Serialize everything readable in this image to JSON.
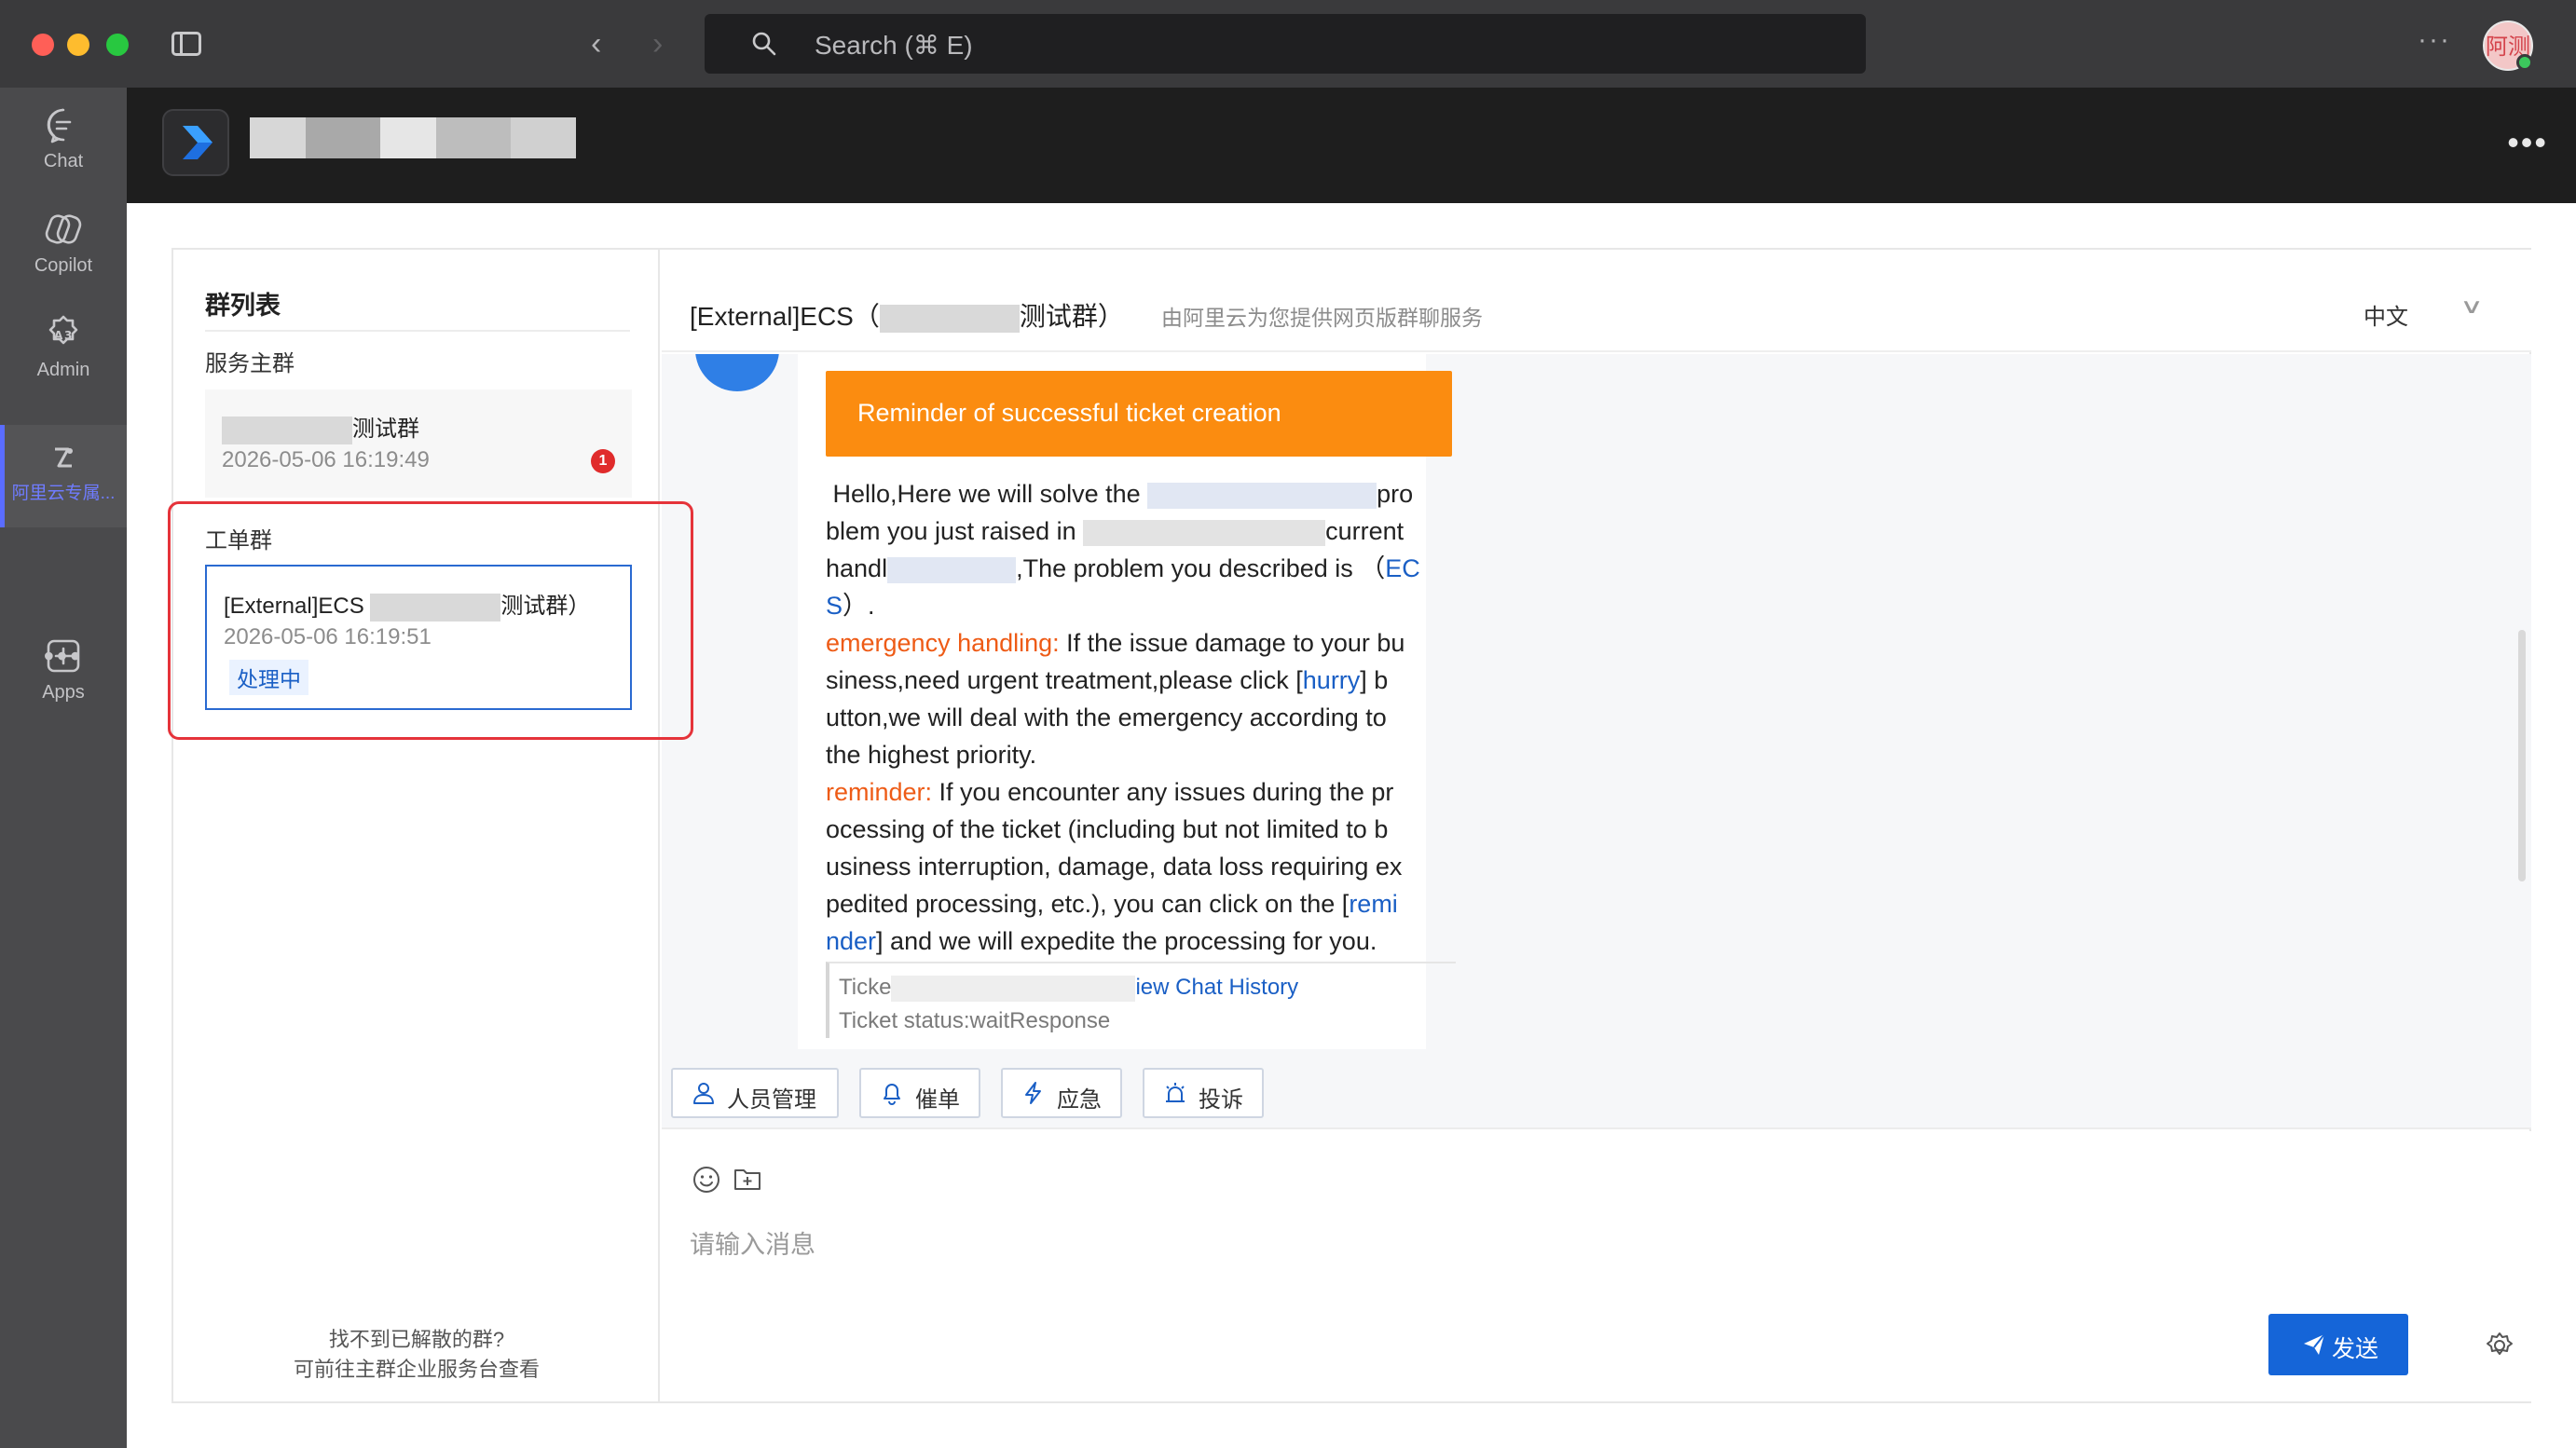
{
  "window": {
    "search_placeholder": "Search (⌘ E)",
    "avatar_text": "阿测",
    "nav_back": "‹",
    "nav_forward": "›",
    "more": "···"
  },
  "rail": {
    "items": [
      {
        "label": "Chat",
        "icon": "chat-bubble-icon"
      },
      {
        "label": "Copilot",
        "icon": "copilot-icon"
      },
      {
        "label": "Admin",
        "icon": "admin-icon"
      },
      {
        "label": "阿里云专属...",
        "icon": "aliyun-app-icon"
      },
      {
        "label": "Apps",
        "icon": "plus-square-icon"
      }
    ],
    "more": "•••"
  },
  "app_header": {
    "more": "•••"
  },
  "group_list": {
    "title": "群列表",
    "service_section_label": "服务主群",
    "service_group": {
      "name_suffix": "测试群",
      "time": "2026-05-06 16:19:49",
      "unread": "1"
    },
    "ticket_section_label": "工单群",
    "ticket_group": {
      "name_prefix": "[External]ECS",
      "name_suffix": "测试群）",
      "time": "2026-05-06 16:19:51",
      "status": "处理中"
    },
    "footer_line1": "找不到已解散的群?",
    "footer_line2": "可前往主群企业服务台查看"
  },
  "chat": {
    "title_prefix": "[External]ECS（",
    "title_suffix": "测试群）",
    "subtitle": "由阿里云为您提供网页版群聊服务",
    "language": "中文",
    "language_arrow": "∨",
    "banner": "Reminder of successful ticket creation",
    "body": {
      "l1a": "Hello,Here we will solve the ",
      "l1b": "pro",
      "l2a": "blem you just raised in ",
      "l2b": "current",
      "l3a": "handl",
      "l3b": ",The problem you described is （",
      "l3c": "EC",
      "l4a": "S",
      "l4b": "）.",
      "emergency_label": "emergency handling:",
      "emergency_text1": " If the issue damage to your bu siness,need urgent treatment,please click [",
      "hurry": "hurry",
      "emergency_text2": "] b utton,we will deal with the emergency according to the highest priority.",
      "reminder_label": "reminder:",
      "reminder_text1": " If you encounter any issues during the pr ocessing of the ticket (including but not limited to b usiness interruption, damage, data loss requiring ex pedited processing, etc.), you can click on the [",
      "reminder_link": "remi nder",
      "reminder_text2": "] and we will expedite the processing for you."
    },
    "ticket_quote": {
      "prefix": "Ticke",
      "link": "iew Chat History",
      "status": "Ticket status:waitResponse"
    },
    "toolbar": [
      {
        "label": "人员管理",
        "icon": "person-icon"
      },
      {
        "label": "催单",
        "icon": "bell-icon"
      },
      {
        "label": "应急",
        "icon": "lightning-icon"
      },
      {
        "label": "投诉",
        "icon": "alarm-icon"
      }
    ],
    "input_placeholder": "请输入消息",
    "send_label": "发送"
  },
  "colors": {
    "accent": "#1565d8",
    "banner": "#fb8c10",
    "highlight": "#e5333a",
    "badge": "#e02b2b"
  }
}
